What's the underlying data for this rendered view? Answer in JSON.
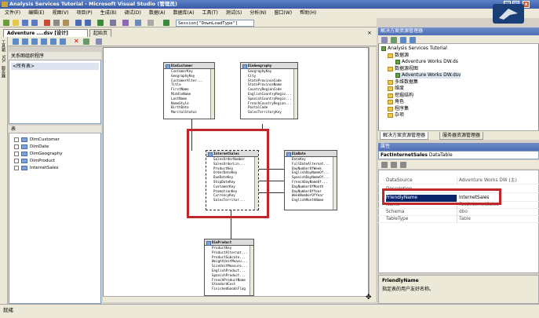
{
  "window": {
    "title": "Analysis Services Tutorial - Microsoft Visual Studio (管理员)"
  },
  "menu": [
    "文件(F)",
    "编辑(E)",
    "视图(V)",
    "项目(P)",
    "生成(B)",
    "调试(D)",
    "数据(A)",
    "数据库(A)",
    "工具(T)",
    "测试(S)",
    "分析(N)",
    "窗口(W)",
    "帮助(H)"
  ],
  "toolbar": {
    "session_value": "Session[\"DownLoadType\"]"
  },
  "doc_tabs": [
    "Adventure ....dsv [设计]",
    "起始页"
  ],
  "left_tools": [
    "工具箱",
    "SQL",
    "服务器"
  ],
  "left_panel": {
    "org_title": "关系图组织程序",
    "org_item": "<所有表>",
    "tables_title": "表",
    "tables": [
      "DimCustomer",
      "DimDate",
      "DimGeography",
      "DimProduct",
      "InternetSales"
    ]
  },
  "entities": {
    "customer": {
      "name": "DimCustomer",
      "cols": [
        "CustomerKey",
        "GeographyKey",
        "CustomerAlter...",
        "Title",
        "FirstName",
        "MiddleName",
        "LastName",
        "NameStyle",
        "BirthDate",
        "MaritalStatus"
      ]
    },
    "geography": {
      "name": "DimGeography",
      "cols": [
        "GeographyKey",
        "City",
        "StateProvinceCode",
        "StateProvinceName",
        "CountryRegionCode",
        "EnglishCountryRegio...",
        "SpanishCountryRegio...",
        "FrenchCountryRegion...",
        "PostalCode",
        "SalesTerritoryKey"
      ]
    },
    "sales": {
      "name": "InternetSales",
      "cols": [
        "SalesOrderNumber",
        "SalesOrderLin...",
        "ProductKey",
        "OrderDateKey",
        "DueDateKey",
        "ShipDateKey",
        "CustomerKey",
        "PromotionKey",
        "CurrencyKey",
        "SalesTerritor..."
      ]
    },
    "date": {
      "name": "DimDate",
      "cols": [
        "DateKey",
        "FullDateAlternat...",
        "DayNumberOfWeek",
        "EnglishDayNameOf...",
        "SpanishDayNameOf...",
        "FrenchDayNameOf...",
        "DayNumberOfMonth",
        "DayNumberOfYear",
        "WeekNumberOfYear",
        "EnglishMonthName"
      ]
    },
    "product": {
      "name": "DimProduct",
      "cols": [
        "ProductKey",
        "ProductAlternat...",
        "ProductSubcate...",
        "WeightUnitMeasu...",
        "SizeUnitMeasure...",
        "EnglishProduct...",
        "SpanishProduct...",
        "FrenchProductName",
        "StandardCost",
        "FinishedGoodsFlag"
      ]
    }
  },
  "solution": {
    "header": "解决方案资源管理器",
    "items": [
      {
        "label": "Analysis Services Tutorial",
        "level": 0
      },
      {
        "label": "数据源",
        "level": 1
      },
      {
        "label": "Adventure Works DW.ds",
        "level": 2
      },
      {
        "label": "数据源视图",
        "level": 1
      },
      {
        "label": "Adventure Works DW.dsv",
        "level": 2
      },
      {
        "label": "多维数据集",
        "level": 1
      },
      {
        "label": "维度",
        "level": 1
      },
      {
        "label": "挖掘结构",
        "level": 1
      },
      {
        "label": "角色",
        "level": 1
      },
      {
        "label": "程序集",
        "level": 1
      },
      {
        "label": "杂项",
        "level": 1
      }
    ],
    "tabs": [
      "解决方案资源管理器",
      "服务器资源管理器"
    ]
  },
  "properties": {
    "header": "属性",
    "object_name": "FactInternetSales",
    "object_type": "DataTable",
    "rows": [
      {
        "name": "DataSource",
        "value": "Adventure Works DW (主)"
      },
      {
        "name": "Description",
        "value": ""
      },
      {
        "name": "FriendlyName",
        "value": "InternetSales"
      },
      {
        "name": "Name",
        "value": "FactInternetSales"
      },
      {
        "name": "Schema",
        "value": "dbo"
      },
      {
        "name": "TableType",
        "value": "Table"
      }
    ],
    "desc_title": "FriendlyName",
    "desc_text": "指定表的用户友好名称。"
  },
  "status": {
    "text": "就绪"
  },
  "colors": {
    "highlight": "#c0262a",
    "title_blue": "#3a5aa8",
    "selected_row": "#0a246a"
  }
}
